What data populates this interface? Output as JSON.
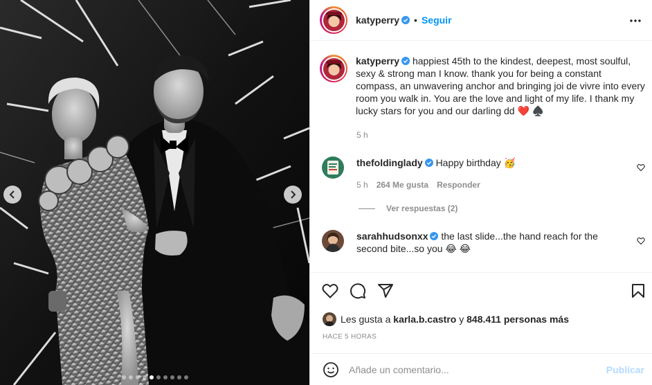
{
  "header": {
    "username": "katyperry",
    "separator": "•",
    "follow_label": "Seguir"
  },
  "caption": {
    "username": "katyperry",
    "text": "happiest 45th to the kindest, deepest, most soulful, sexy & strong man I know. thank you for being a constant compass, an unwavering anchor and bringing joi de vivre into every room you walk in. You are the love and light of my life. I thank my lucky stars for you and our darling dd ❤️ ♠️",
    "time": "5 h"
  },
  "comments": [
    {
      "username": "thefoldinglady",
      "text": "Happy birthday 🥳",
      "time": "5 h",
      "likes": "264 Me gusta",
      "reply": "Responder"
    },
    {
      "username": "sarahhudsonxx",
      "text": "the last slide...the hand reach for the second bite...so you 😂 😂"
    }
  ],
  "view_replies": "Ver respuestas (2)",
  "likes": {
    "prefix": "Les gusta a",
    "user": "karla.b.castro",
    "and": "y",
    "count": "848.411 personas más"
  },
  "timestamp": "HACE 5 HORAS",
  "comment_input": {
    "placeholder": "Añade un comentario...",
    "publish_label": "Publicar"
  },
  "carousel": {
    "total_slides": 10,
    "active_index": 4
  },
  "colors": {
    "accent": "#0095f6",
    "verified": "#3897f0",
    "publish_disabled": "#b3dbff",
    "muted": "#8e8e8e"
  },
  "icons": [
    "verified-badge-icon",
    "more-options-icon",
    "heart-icon",
    "comment-icon",
    "share-icon",
    "bookmark-icon",
    "emoji-icon",
    "chevron-left-icon",
    "chevron-right-icon"
  ]
}
